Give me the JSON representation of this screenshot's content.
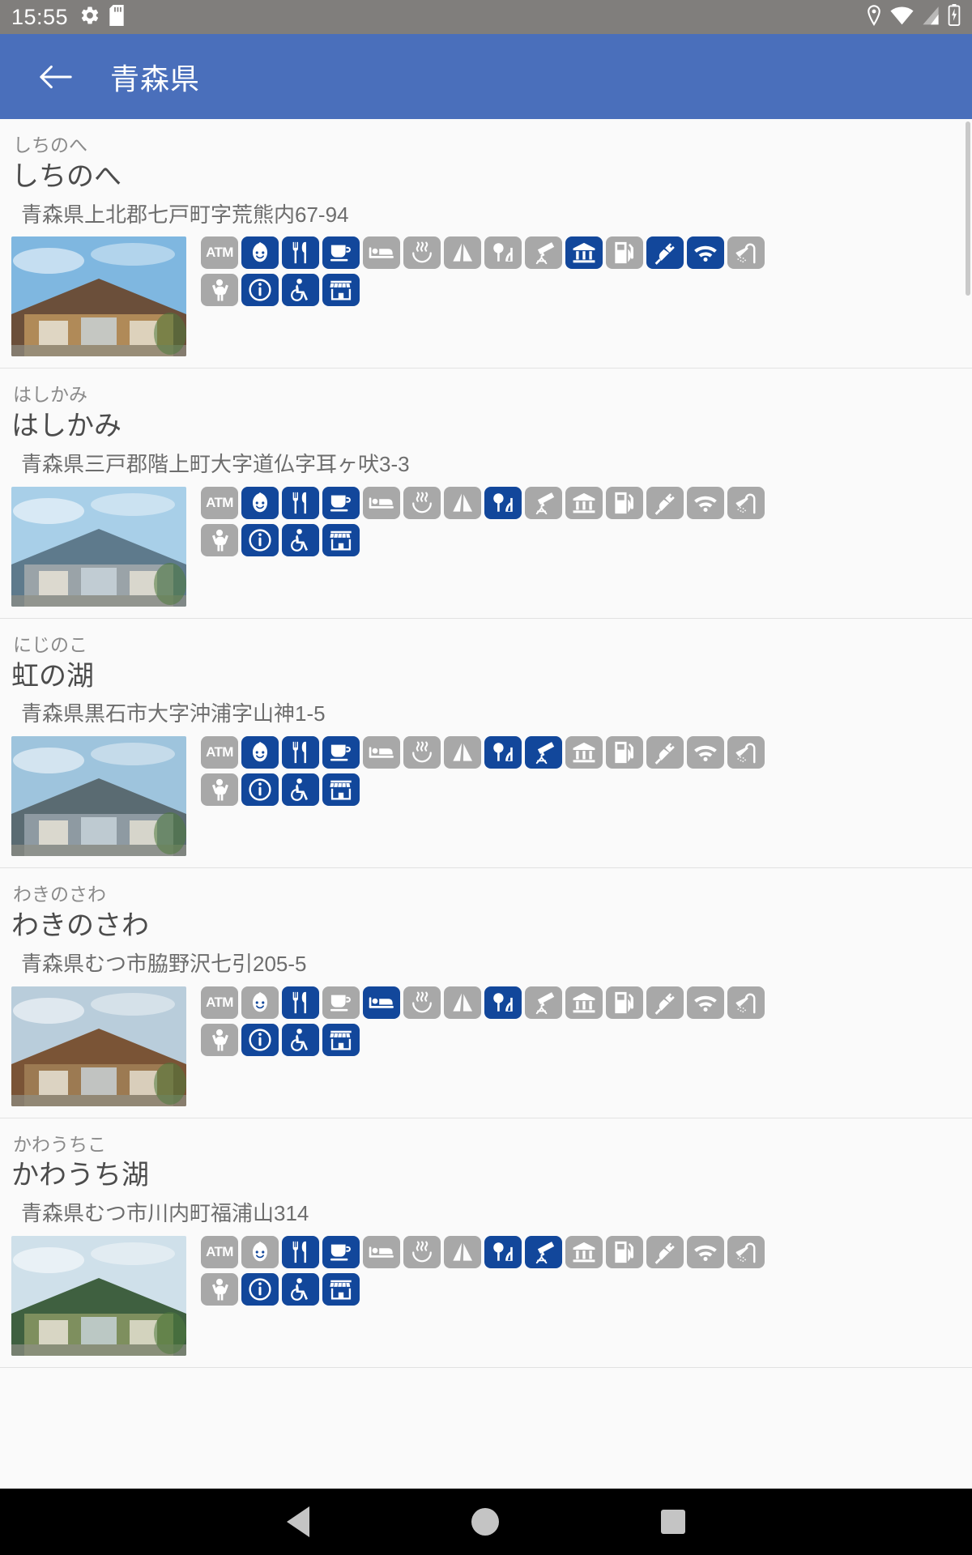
{
  "statusbar": {
    "clock": "15:55",
    "left_icons": [
      "gear-icon",
      "sd-card-icon"
    ],
    "right_icons": [
      "location-pin-icon",
      "wifi-icon",
      "cell-signal-icon",
      "battery-icon"
    ]
  },
  "appbar": {
    "back_icon": "arrow-left-icon",
    "title": "青森県"
  },
  "facility_legend": [
    {
      "key": "atm",
      "label": "ATM"
    },
    {
      "key": "baby",
      "label": "ベビー"
    },
    {
      "key": "restaurant",
      "label": "レストラン"
    },
    {
      "key": "cafe",
      "label": "喫茶"
    },
    {
      "key": "hotel",
      "label": "宿泊"
    },
    {
      "key": "onsen",
      "label": "温泉"
    },
    {
      "key": "camp",
      "label": "キャンプ"
    },
    {
      "key": "park",
      "label": "公園"
    },
    {
      "key": "observatory",
      "label": "天文台"
    },
    {
      "key": "museum",
      "label": "美術館"
    },
    {
      "key": "gas",
      "label": "ガソリンスタンド"
    },
    {
      "key": "ev",
      "label": "EV充電"
    },
    {
      "key": "wifi",
      "label": "Wi-Fi"
    },
    {
      "key": "shower",
      "label": "シャワー"
    },
    {
      "key": "playground",
      "label": "遊具"
    },
    {
      "key": "info",
      "label": "案内所"
    },
    {
      "key": "accessible",
      "label": "バリアフリー"
    },
    {
      "key": "shop",
      "label": "売店"
    }
  ],
  "items": [
    {
      "kana": "しちのへ",
      "name": "しちのへ",
      "address": "青森県上北郡七戸町字荒熊内67-94",
      "thumb": "roadside-station-photo",
      "active": [
        "baby",
        "restaurant",
        "cafe",
        "museum",
        "ev",
        "wifi",
        "info",
        "accessible",
        "shop"
      ]
    },
    {
      "kana": "はしかみ",
      "name": "はしかみ",
      "address": "青森県三戸郡階上町大字道仏字耳ヶ吠3-3",
      "thumb": "roadside-station-photo",
      "active": [
        "baby",
        "restaurant",
        "cafe",
        "park",
        "info",
        "accessible",
        "shop"
      ]
    },
    {
      "kana": "にじのこ",
      "name": "虹の湖",
      "address": "青森県黒石市大字沖浦字山神1-5",
      "thumb": "roadside-station-photo",
      "active": [
        "baby",
        "restaurant",
        "cafe",
        "park",
        "observatory",
        "info",
        "accessible",
        "shop"
      ]
    },
    {
      "kana": "わきのさわ",
      "name": "わきのさわ",
      "address": "青森県むつ市脇野沢七引205-5",
      "thumb": "roadside-station-photo",
      "active": [
        "restaurant",
        "hotel",
        "park",
        "info",
        "accessible",
        "shop"
      ]
    },
    {
      "kana": "かわうちこ",
      "name": "かわうち湖",
      "address": "青森県むつ市川内町福浦山314",
      "thumb": "roadside-station-photo",
      "active": [
        "restaurant",
        "cafe",
        "park",
        "observatory",
        "info",
        "accessible",
        "shop"
      ]
    }
  ],
  "navbar": {
    "back": "nav-back-triangle",
    "home": "nav-home-circle",
    "recents": "nav-recents-square"
  },
  "colors": {
    "appbar": "#4a6fbb",
    "statusbar": "#807e7c",
    "icon_on": "#12479b",
    "icon_off": "#a8a8a8",
    "list_bg": "#fafafa"
  }
}
